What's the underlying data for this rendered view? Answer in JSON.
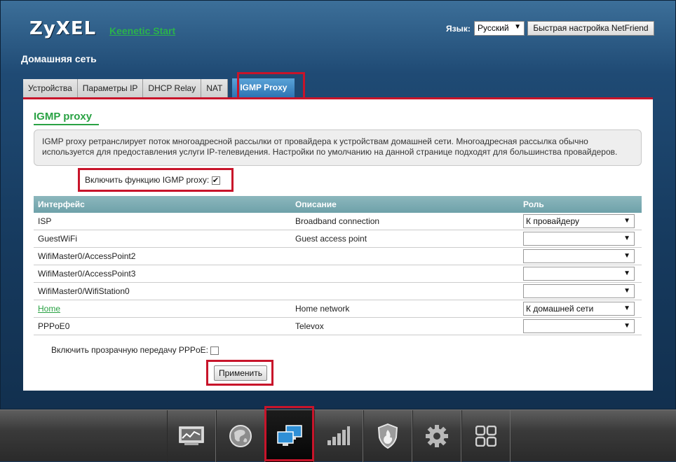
{
  "header": {
    "brand": "ZyXEL",
    "product_link": "Keenetic Start",
    "language_label": "Язык:",
    "language_value": "Русский",
    "netfriend_button": "Быстрая настройка NetFriend"
  },
  "section_title": "Домашняя сеть",
  "tabs": [
    {
      "label": "Устройства"
    },
    {
      "label": "Параметры IP"
    },
    {
      "label": "DHCP Relay"
    },
    {
      "label": "NAT"
    },
    {
      "label": "IGMP Proxy",
      "active": true
    }
  ],
  "panel": {
    "title": "IGMP proxy",
    "info": "IGMP proxy ретранслирует поток многоадресной рассылки от провайдера к устройствам домашней сети. Многоадресная рассылка обычно используется для предоставления услуги IP-телевидения. Настройки по умолчанию на данной странице подходят для большинства провайдеров.",
    "enable_label": "Включить функцию IGMP proxy:",
    "enable_checked": true,
    "table": {
      "headers": [
        "Интерфейс",
        "Описание",
        "Роль"
      ],
      "rows": [
        {
          "interface": "ISP",
          "description": "Broadband connection",
          "role": "К провайдеру"
        },
        {
          "interface": "GuestWiFi",
          "description": "Guest access point",
          "role": ""
        },
        {
          "interface": "WifiMaster0/AccessPoint2",
          "description": "",
          "role": ""
        },
        {
          "interface": "WifiMaster0/AccessPoint3",
          "description": "",
          "role": ""
        },
        {
          "interface": "WifiMaster0/WifiStation0",
          "description": "",
          "role": ""
        },
        {
          "interface": "Home",
          "description": "Home network",
          "role": "К домашней сети"
        },
        {
          "interface": "PPPoE0",
          "description": "Televox",
          "role": ""
        }
      ]
    },
    "pppoe_label": "Включить прозрачную передачу PPPoE:",
    "pppoe_checked": false,
    "apply_button": "Применить"
  },
  "bottom_nav": [
    {
      "icon": "monitor-chart-icon"
    },
    {
      "icon": "globe-icon"
    },
    {
      "icon": "home-network-icon",
      "active": true
    },
    {
      "icon": "signal-bars-icon"
    },
    {
      "icon": "security-shield-icon"
    },
    {
      "icon": "settings-gear-icon"
    },
    {
      "icon": "apps-grid-icon"
    }
  ],
  "colors": {
    "accent_red": "#c8142a",
    "link_green": "#2aa244",
    "tab_active": "#2d74b3",
    "table_header": "#7aa9b0"
  }
}
